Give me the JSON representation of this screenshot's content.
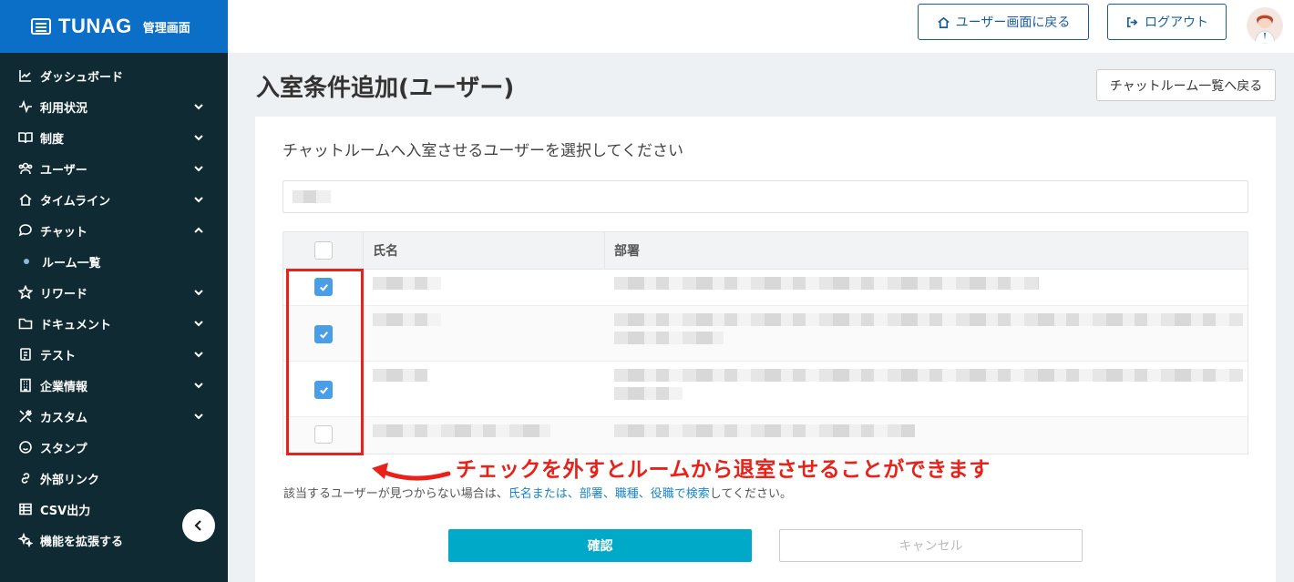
{
  "brand": {
    "logo": "TUNAG",
    "subtitle": "管理画面"
  },
  "sidebar": {
    "items": [
      {
        "label": "ダッシュボード",
        "icon": "chart-line-icon",
        "chevron": ""
      },
      {
        "label": "利用状況",
        "icon": "pulse-icon",
        "chevron": "down"
      },
      {
        "label": "制度",
        "icon": "book-icon",
        "chevron": "down"
      },
      {
        "label": "ユーザー",
        "icon": "users-icon",
        "chevron": "down"
      },
      {
        "label": "タイムライン",
        "icon": "home-icon",
        "chevron": "down"
      },
      {
        "label": "チャット",
        "icon": "chat-bubble-icon",
        "chevron": "up"
      },
      {
        "label": "ルーム一覧",
        "icon": "",
        "chevron": "",
        "sub": true
      },
      {
        "label": "リワード",
        "icon": "star-icon",
        "chevron": "down"
      },
      {
        "label": "ドキュメント",
        "icon": "folder-icon",
        "chevron": "down"
      },
      {
        "label": "テスト",
        "icon": "clipboard-icon",
        "chevron": "down"
      },
      {
        "label": "企業情報",
        "icon": "building-icon",
        "chevron": "down"
      },
      {
        "label": "カスタム",
        "icon": "tools-icon",
        "chevron": "down"
      },
      {
        "label": "スタンプ",
        "icon": "smile-icon",
        "chevron": ""
      },
      {
        "label": "外部リンク",
        "icon": "link-icon",
        "chevron": ""
      },
      {
        "label": "CSV出力",
        "icon": "table-icon",
        "chevron": ""
      },
      {
        "label": "機能を拡張する",
        "icon": "sparkle-icon",
        "chevron": ""
      }
    ]
  },
  "header": {
    "user_screen_label": "ユーザー画面に戻る",
    "logout_label": "ログアウト"
  },
  "main": {
    "title": "入室条件追加(ユーザー)",
    "back_label": "チャットルーム一覧へ戻る",
    "heading": "チャットルームへ入室させるユーザーを選択してください",
    "table": {
      "columns": [
        "氏名",
        "部署"
      ],
      "rows": [
        {
          "checked": true
        },
        {
          "checked": true
        },
        {
          "checked": true
        },
        {
          "checked": false
        }
      ]
    },
    "annotation": "チェックを外すとルームから退室させることができます",
    "notice_prefix": "該当するユーザーが見つからない場合は、",
    "notice_link": "氏名または、部署、職種、役職で検索",
    "notice_suffix": "してください。",
    "confirm_label": "確認",
    "cancel_label": "キャンセル"
  },
  "colors": {
    "sidebar": "#0f2a33",
    "brand": "#0b6fc7",
    "accent": "#00a9c8",
    "checkbox": "#4a9ee8",
    "annotation": "#e8211a"
  }
}
